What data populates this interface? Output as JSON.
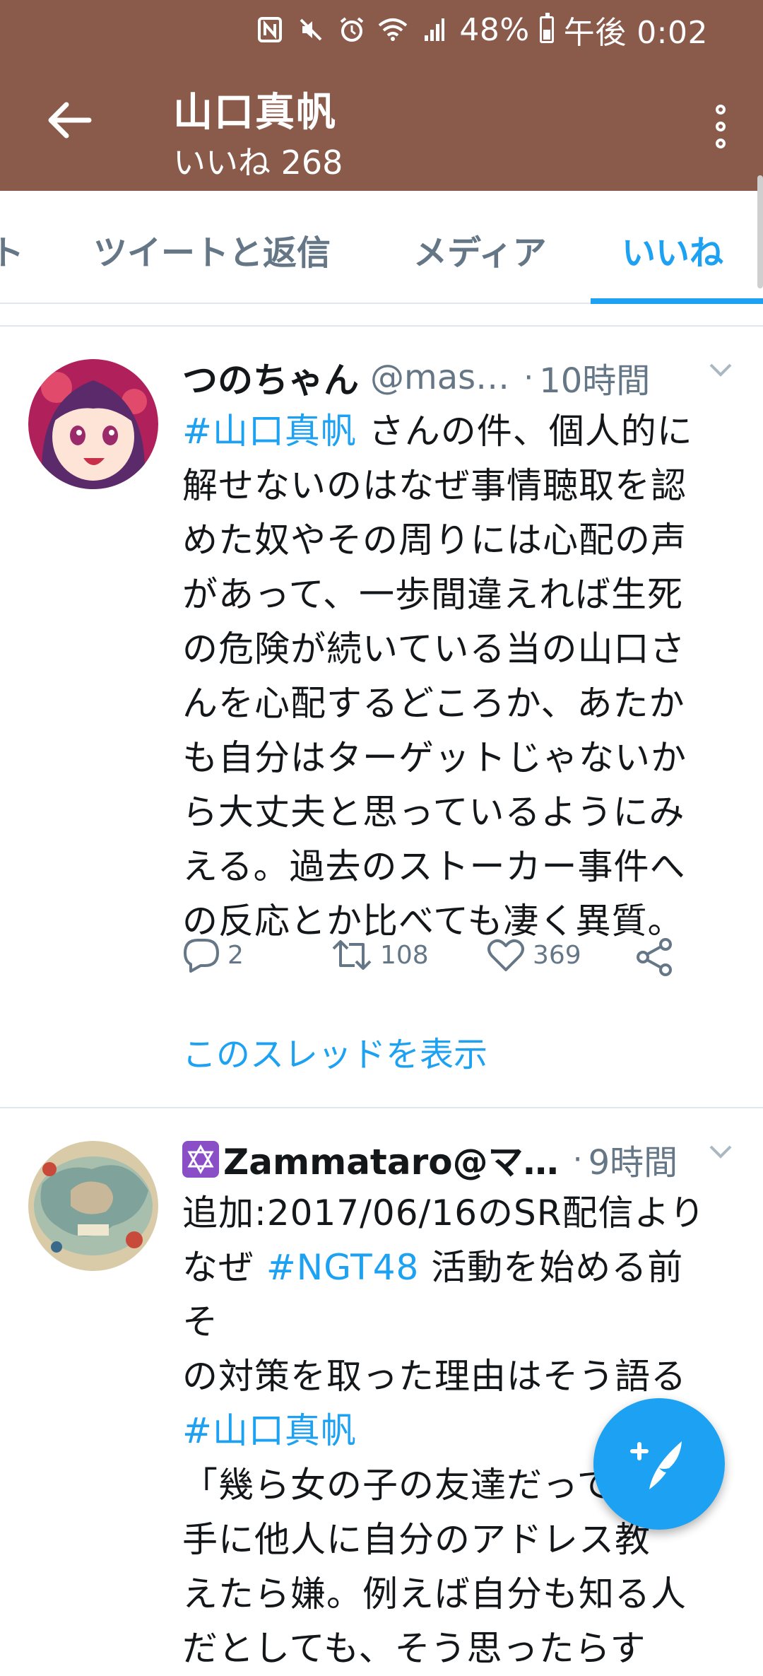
{
  "status_bar": {
    "battery": "48%",
    "time": "午後 0:02",
    "icons": [
      "nfc-icon",
      "mute-icon",
      "alarm-icon",
      "wifi-icon",
      "signal-icon",
      "battery-icon"
    ]
  },
  "app_bar": {
    "title": "山口真帆",
    "subtitle": "いいね 268"
  },
  "tabs": [
    {
      "label": "ト"
    },
    {
      "label": "ツイートと返信"
    },
    {
      "label": "メディア"
    },
    {
      "label": "いいね",
      "active": true
    }
  ],
  "tweets": [
    {
      "name": "つのちゃん",
      "handle": "@mas…",
      "time": "10時間",
      "lines": [
        {
          "hashtag": "#山口真帆",
          "text": " さんの件、個人的に"
        },
        {
          "text": "解せないのはなぜ事情聴取を認"
        },
        {
          "text": "めた奴やその周りには心配の声"
        },
        {
          "text": "があって、一歩間違えれば生死"
        },
        {
          "text": "の危険が続いている当の山口さ"
        },
        {
          "text": "んを心配するどころか、あたか"
        },
        {
          "text": "も自分はターゲットじゃないか"
        },
        {
          "text": "ら大丈夫と思っているようにみ"
        },
        {
          "text": "える。過去のストーカー事件へ"
        },
        {
          "text": "の反応とか比べても凄く異質。"
        }
      ],
      "replies": "2",
      "retweets": "108",
      "likes": "369",
      "thread_link": "このスレッドを表示"
    },
    {
      "name": "Zammataro@マ…",
      "time": "9時間",
      "line1": "追加:2017/06/16のSR配信より",
      "line2_pre": "なぜ ",
      "line2_tag": "#NGT48",
      "line2_post": " 活動を始める前そ",
      "line3": "の対策を取った理由はそう語る",
      "line4_tag": "#山口真帆",
      "line5": "「幾ら女の子の友達だって勝",
      "line6": "手に他人に自分のアドレス教",
      "line7": "えたら嫌。例えば自分も知る人",
      "line8": "だとしても、そう思ったらす"
    }
  ],
  "colors": {
    "header": "#8a5a4a",
    "accent": "#1da1f2",
    "muted": "#657786"
  }
}
